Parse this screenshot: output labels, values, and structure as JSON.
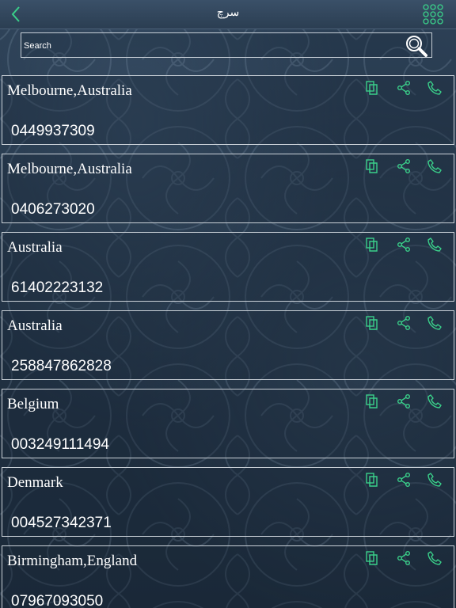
{
  "header": {
    "title": "سرچ",
    "back_icon": "chevron-left-icon",
    "menu_icon": "grid-menu-icon"
  },
  "search": {
    "placeholder": "Search",
    "icon": "magnifier-icon"
  },
  "colors": {
    "accent": "#3ad08a",
    "background": "#223345",
    "card_border": "#c9d0d7"
  },
  "contacts": [
    {
      "location": "Melbourne,Australia",
      "number": "0449937309"
    },
    {
      "location": "Melbourne,Australia",
      "number": "0406273020"
    },
    {
      "location": "Australia",
      "number": "61402223132"
    },
    {
      "location": "Australia",
      "number": "258847862828"
    },
    {
      "location": "Belgium",
      "number": "003249111494"
    },
    {
      "location": "Denmark",
      "number": "004527342371"
    },
    {
      "location": "Birmingham,England",
      "number": "07967093050"
    }
  ],
  "actions": [
    "copy-icon",
    "share-icon",
    "phone-icon"
  ]
}
